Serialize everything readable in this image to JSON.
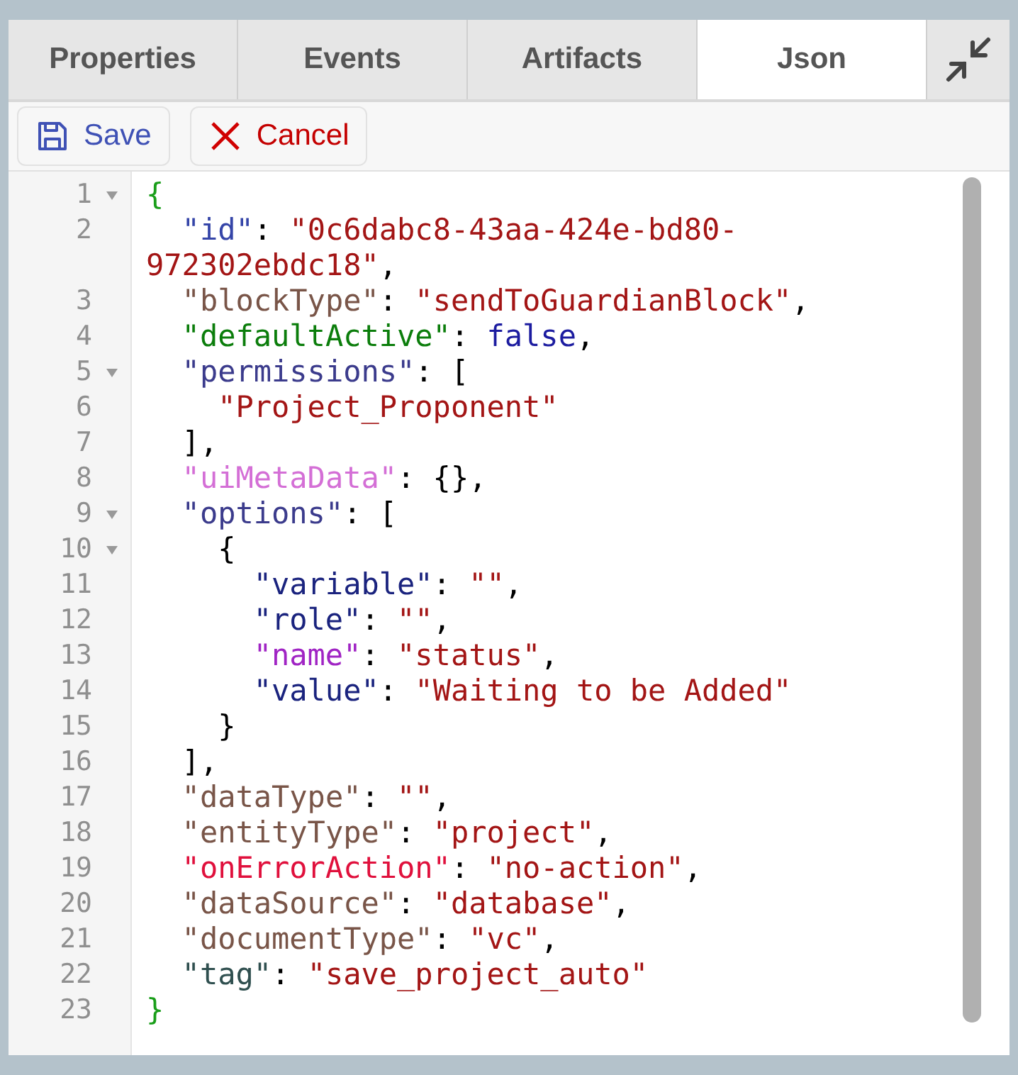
{
  "tabs": [
    {
      "label": "Properties",
      "selected": false
    },
    {
      "label": "Events",
      "selected": false
    },
    {
      "label": "Artifacts",
      "selected": false
    },
    {
      "label": "Json",
      "selected": true
    }
  ],
  "toolbar": {
    "save": "Save",
    "cancel": "Cancel"
  },
  "editor": {
    "lines": [
      {
        "number": "1",
        "fold": true,
        "tokens": [
          {
            "text": "{",
            "color": "#1a9e1a"
          }
        ]
      },
      {
        "number": "2",
        "fold": false,
        "tokens": [
          {
            "text": "  \"id\"",
            "color": "#3545a8"
          },
          {
            "text": ": ",
            "color": "#000000"
          },
          {
            "text": "\"0c6dabc8-43aa-424e-bd80-972302ebdc18\"",
            "color": "#a31515"
          },
          {
            "text": ",",
            "color": "#000000"
          }
        ]
      },
      {
        "number": "3",
        "fold": false,
        "tokens": [
          {
            "text": "  \"blockType\"",
            "color": "#795548"
          },
          {
            "text": ": ",
            "color": "#000000"
          },
          {
            "text": "\"sendToGuardianBlock\"",
            "color": "#a31515"
          },
          {
            "text": ",",
            "color": "#000000"
          }
        ]
      },
      {
        "number": "4",
        "fold": false,
        "tokens": [
          {
            "text": "  \"defaultActive\"",
            "color": "#0b7d0b"
          },
          {
            "text": ": ",
            "color": "#000000"
          },
          {
            "text": "false",
            "color": "#1c1ca0"
          },
          {
            "text": ",",
            "color": "#000000"
          }
        ]
      },
      {
        "number": "5",
        "fold": true,
        "tokens": [
          {
            "text": "  \"permissions\"",
            "color": "#3b3b8c"
          },
          {
            "text": ": [",
            "color": "#000000"
          }
        ]
      },
      {
        "number": "6",
        "fold": false,
        "tokens": [
          {
            "text": "    \"Project_Proponent\"",
            "color": "#a31515"
          }
        ]
      },
      {
        "number": "7",
        "fold": false,
        "tokens": [
          {
            "text": "  ],",
            "color": "#000000"
          }
        ]
      },
      {
        "number": "8",
        "fold": false,
        "tokens": [
          {
            "text": "  \"uiMetaData\"",
            "color": "#d46fd6"
          },
          {
            "text": ": {},",
            "color": "#000000"
          }
        ]
      },
      {
        "number": "9",
        "fold": true,
        "tokens": [
          {
            "text": "  \"options\"",
            "color": "#3b3b8c"
          },
          {
            "text": ": [",
            "color": "#000000"
          }
        ]
      },
      {
        "number": "10",
        "fold": true,
        "tokens": [
          {
            "text": "    {",
            "color": "#000000"
          }
        ]
      },
      {
        "number": "11",
        "fold": false,
        "tokens": [
          {
            "text": "      \"variable\"",
            "color": "#1a237e"
          },
          {
            "text": ": ",
            "color": "#000000"
          },
          {
            "text": "\"\"",
            "color": "#a31515"
          },
          {
            "text": ",",
            "color": "#000000"
          }
        ]
      },
      {
        "number": "12",
        "fold": false,
        "tokens": [
          {
            "text": "      \"role\"",
            "color": "#1a237e"
          },
          {
            "text": ": ",
            "color": "#000000"
          },
          {
            "text": "\"\"",
            "color": "#a31515"
          },
          {
            "text": ",",
            "color": "#000000"
          }
        ]
      },
      {
        "number": "13",
        "fold": false,
        "tokens": [
          {
            "text": "      \"name\"",
            "color": "#a024c4"
          },
          {
            "text": ": ",
            "color": "#000000"
          },
          {
            "text": "\"status\"",
            "color": "#a31515"
          },
          {
            "text": ",",
            "color": "#000000"
          }
        ]
      },
      {
        "number": "14",
        "fold": false,
        "tokens": [
          {
            "text": "      \"value\"",
            "color": "#1a237e"
          },
          {
            "text": ": ",
            "color": "#000000"
          },
          {
            "text": "\"Waiting to be Added\"",
            "color": "#a31515"
          }
        ]
      },
      {
        "number": "15",
        "fold": false,
        "tokens": [
          {
            "text": "    }",
            "color": "#000000"
          }
        ]
      },
      {
        "number": "16",
        "fold": false,
        "tokens": [
          {
            "text": "  ],",
            "color": "#000000"
          }
        ]
      },
      {
        "number": "17",
        "fold": false,
        "tokens": [
          {
            "text": "  \"dataType\"",
            "color": "#795548"
          },
          {
            "text": ": ",
            "color": "#000000"
          },
          {
            "text": "\"\"",
            "color": "#a31515"
          },
          {
            "text": ",",
            "color": "#000000"
          }
        ]
      },
      {
        "number": "18",
        "fold": false,
        "tokens": [
          {
            "text": "  \"entityType\"",
            "color": "#795548"
          },
          {
            "text": ": ",
            "color": "#000000"
          },
          {
            "text": "\"project\"",
            "color": "#a31515"
          },
          {
            "text": ",",
            "color": "#000000"
          }
        ]
      },
      {
        "number": "19",
        "fold": false,
        "tokens": [
          {
            "text": "  \"onErrorAction\"",
            "color": "#e0103c"
          },
          {
            "text": ": ",
            "color": "#000000"
          },
          {
            "text": "\"no-action\"",
            "color": "#a31515"
          },
          {
            "text": ",",
            "color": "#000000"
          }
        ]
      },
      {
        "number": "20",
        "fold": false,
        "tokens": [
          {
            "text": "  \"dataSource\"",
            "color": "#795548"
          },
          {
            "text": ": ",
            "color": "#000000"
          },
          {
            "text": "\"database\"",
            "color": "#a31515"
          },
          {
            "text": ",",
            "color": "#000000"
          }
        ]
      },
      {
        "number": "21",
        "fold": false,
        "tokens": [
          {
            "text": "  \"documentType\"",
            "color": "#795548"
          },
          {
            "text": ": ",
            "color": "#000000"
          },
          {
            "text": "\"vc\"",
            "color": "#a31515"
          },
          {
            "text": ",",
            "color": "#000000"
          }
        ]
      },
      {
        "number": "22",
        "fold": false,
        "tokens": [
          {
            "text": "  \"tag\"",
            "color": "#2f4f4f"
          },
          {
            "text": ": ",
            "color": "#000000"
          },
          {
            "text": "\"save_project_auto\"",
            "color": "#a31515"
          }
        ]
      },
      {
        "number": "23",
        "fold": false,
        "tokens": [
          {
            "text": "}",
            "color": "#1a9e1a"
          }
        ]
      }
    ]
  }
}
